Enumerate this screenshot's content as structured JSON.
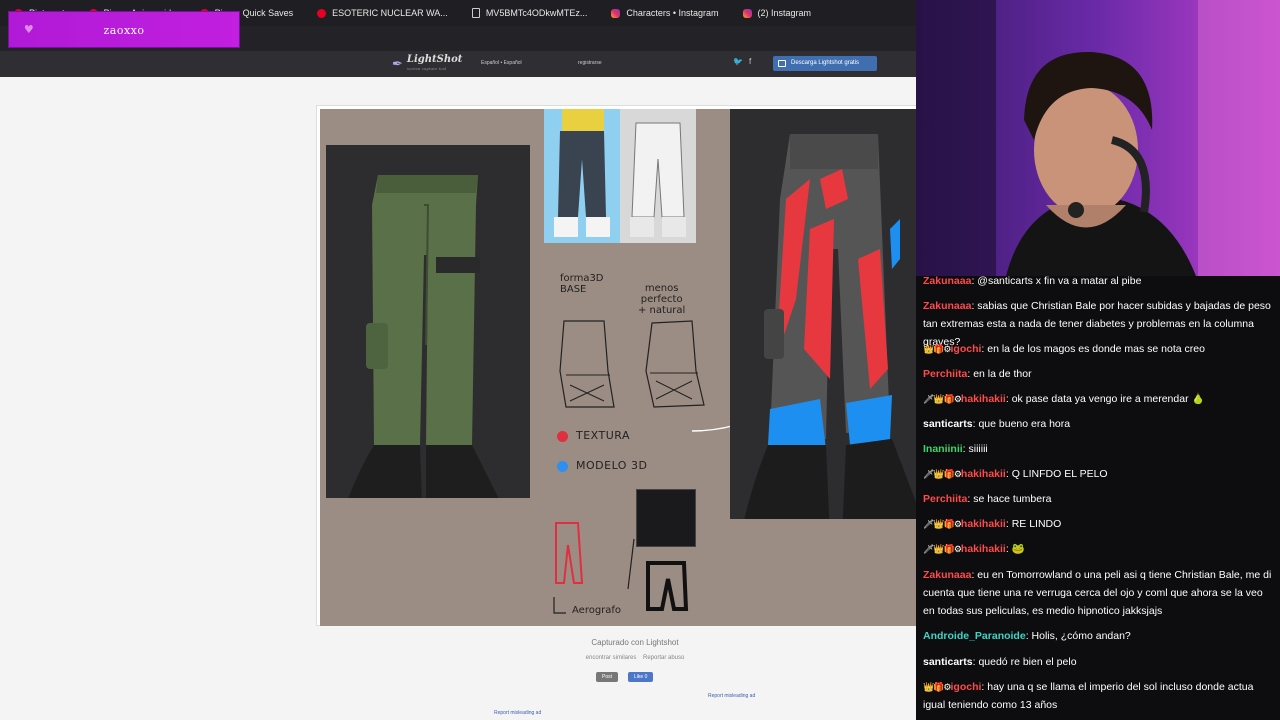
{
  "bookmarks": [
    {
      "label": "Pinterest",
      "icon": "pinterest-icon"
    },
    {
      "label": "Pin en Anime girls",
      "icon": "pinterest-icon"
    },
    {
      "label": "Pin en Quick Saves",
      "icon": "pinterest-icon"
    },
    {
      "label": "ESOTERIC NUCLEAR WA...",
      "icon": "pinterest-icon"
    },
    {
      "label": "MV5BMTc4ODkwMTEz...",
      "icon": "document-icon"
    },
    {
      "label": "Characters • Instagram",
      "icon": "instagram-icon"
    },
    {
      "label": "(2) Instagram",
      "icon": "instagram-icon"
    }
  ],
  "overlay": {
    "name": "zaoxxo"
  },
  "lightshot": {
    "logo": "LightShot",
    "logo_sub": "screen capture tool",
    "language": "Español • Español",
    "register": "registrarse",
    "social": [
      "twitter-icon",
      "facebook-icon"
    ],
    "download_label": "Descarga Lightshot gratis",
    "caption": "Capturado con Lightshot",
    "find_similar": "encontrar similares",
    "report_abuse": "Reportar abuso",
    "post_label": "Post",
    "like_label": "Like 0",
    "report_ad_1": "Report misleading ad",
    "report_ad_2": "Report misleading ad"
  },
  "artwork": {
    "note_base": "forma3D\nBASE",
    "note_natural": "menos\nperfecto\n+ natural",
    "legend": [
      {
        "label": "TEXTURA",
        "color": "#e03040"
      },
      {
        "label": "MODELO 3D",
        "color": "#2d8ff0"
      }
    ],
    "note_airbrush": "Aerografo"
  },
  "chat": {
    "messages": [
      {
        "user": "Zakunaaa",
        "color": "#ff4b4b",
        "badges": "",
        "text": "@santicarts x fin va a matar al pibe"
      },
      {
        "user": "Zakunaaa",
        "color": "#ff4b4b",
        "badges": "",
        "text": "sabias que Christian Bale por hacer subidas y bajadas de peso tan extremas esta a nada de tener diabetes y problemas en la columna graves?"
      },
      {
        "user": "igochi",
        "color": "#ff4b4b",
        "badges": "👑🎁⚙",
        "text": "en la de los magos es donde mas se nota creo"
      },
      {
        "user": "Perchiita",
        "color": "#ff4b4b",
        "badges": "",
        "text": "en la de thor"
      },
      {
        "user": "hakihakii",
        "color": "#ff4b4b",
        "badges": "🗡👑🎁⚙",
        "text": "ok pase data ya vengo ire a merendar 🍐"
      },
      {
        "user": "santicarts",
        "color": "#ffffff",
        "badges": "",
        "text": "que bueno era hora"
      },
      {
        "user": "Inaniinii",
        "color": "#3fd46a",
        "badges": "",
        "text": "siiiiii"
      },
      {
        "user": "hakihakii",
        "color": "#ff4b4b",
        "badges": "🗡👑🎁⚙",
        "text": "Q LINFDO EL PELO"
      },
      {
        "user": "Perchiita",
        "color": "#ff4b4b",
        "badges": "",
        "text": "se hace tumbera"
      },
      {
        "user": "hakihakii",
        "color": "#ff4b4b",
        "badges": "🗡👑🎁⚙",
        "text": "RE LINDO"
      },
      {
        "user": "hakihakii",
        "color": "#ff4b4b",
        "badges": "🗡👑🎁⚙",
        "text": "🐸"
      },
      {
        "user": "Zakunaaa",
        "color": "#ff4b4b",
        "badges": "",
        "text": "eu en Tomorrowland o una peli asi q tiene Christian Bale, me di cuenta que tiene una re verruga cerca del ojo y coml que ahora se la veo en todas sus peliculas, es medio hipnotico jakksjajs"
      },
      {
        "user": "Androide_Paranoide",
        "color": "#3fd4c4",
        "badges": "",
        "text": "Holis, ¿cómo andan?"
      },
      {
        "user": "santicarts",
        "color": "#ffffff",
        "badges": "",
        "text": "quedó re bien el pelo"
      },
      {
        "user": "igochi",
        "color": "#ff4b4b",
        "badges": "👑🎁⚙",
        "text": "hay una q se llama el imperio del sol incluso donde actua igual teniendo como 13 años"
      }
    ]
  }
}
